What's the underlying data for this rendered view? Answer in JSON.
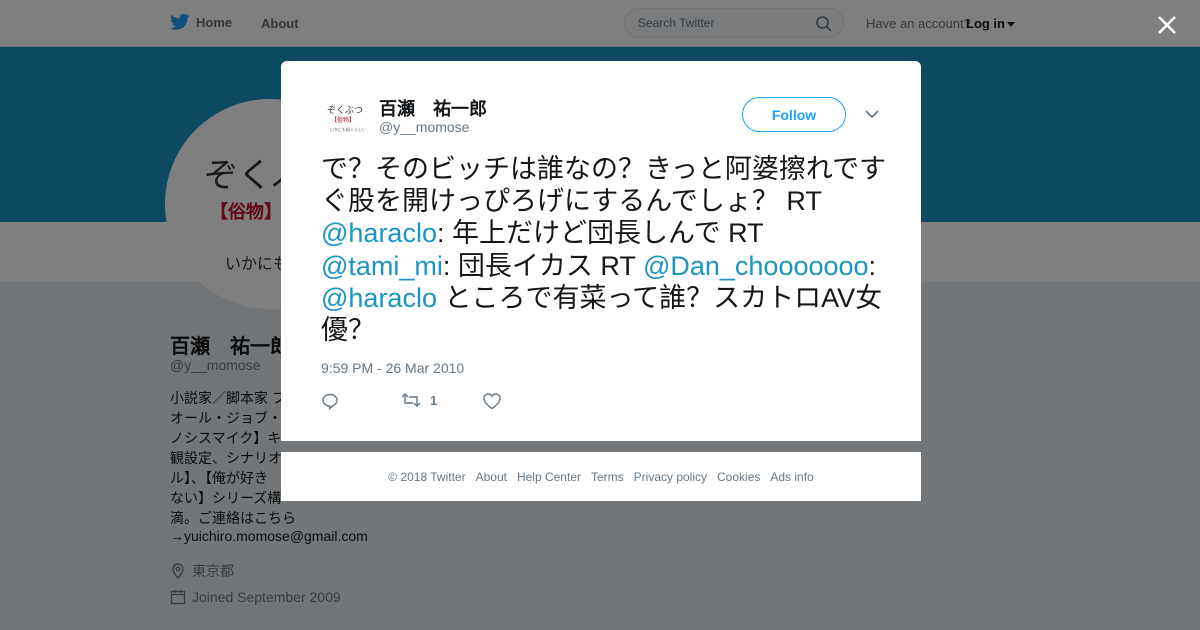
{
  "nav": {
    "home_label": "Home",
    "about_label": "About",
    "search_placeholder": "Search Twitter",
    "have_account": "Have an account?",
    "login_label": "Log in"
  },
  "profile": {
    "name": "百瀬　祐一郎",
    "handle": "@y__momose",
    "avatar_text": "ぞくぶ",
    "avatar_tag": "【俗物】",
    "avatar_sub": "いかにも",
    "bio_lines": [
      "小説家／脚本家 フ",
      "オール・ジョブ・",
      "ノシスマイク】キ",
      "観設定、シナリオ",
      "ル】、【俺が好き",
      "ない】シリーズ構",
      "滴。ご連絡はこちら"
    ],
    "email": "→yuichiro.momose@gmail.com",
    "location": "東京都",
    "joined": "Joined September 2009"
  },
  "tweet": {
    "author_name": "百瀬　祐一郎",
    "author_handle": "@y__momose",
    "avatar_line1": "ぞくぶつ",
    "avatar_line2": "【俗物】",
    "avatar_line3": "いかにも俗人らしい",
    "follow_label": "Follow",
    "text_1": "で？そのビッチは誰なの？きっと阿婆擦れですぐ股を開けっぴろげにするんでしょ？ RT ",
    "mention_1": "@haraclo",
    "text_2": ": 年上だけど団長しんで RT ",
    "mention_2": "@tami_mi",
    "text_3": ": 団長イカス RT ",
    "mention_3": "@Dan_chooooooo",
    "text_4": ": ",
    "mention_4": "@haraclo",
    "text_5": " ところで有菜って誰？スカトロAV女優？",
    "timestamp": "9:59 PM - 26 Mar 2010",
    "retweet_count": "1"
  },
  "footer": {
    "items": [
      "© 2018 Twitter",
      "About",
      "Help Center",
      "Terms",
      "Privacy policy",
      "Cookies",
      "Ads info"
    ]
  },
  "colors": {
    "accent": "#1da1f2",
    "mention": "#1b95c5",
    "banner": "#1b95c5"
  }
}
